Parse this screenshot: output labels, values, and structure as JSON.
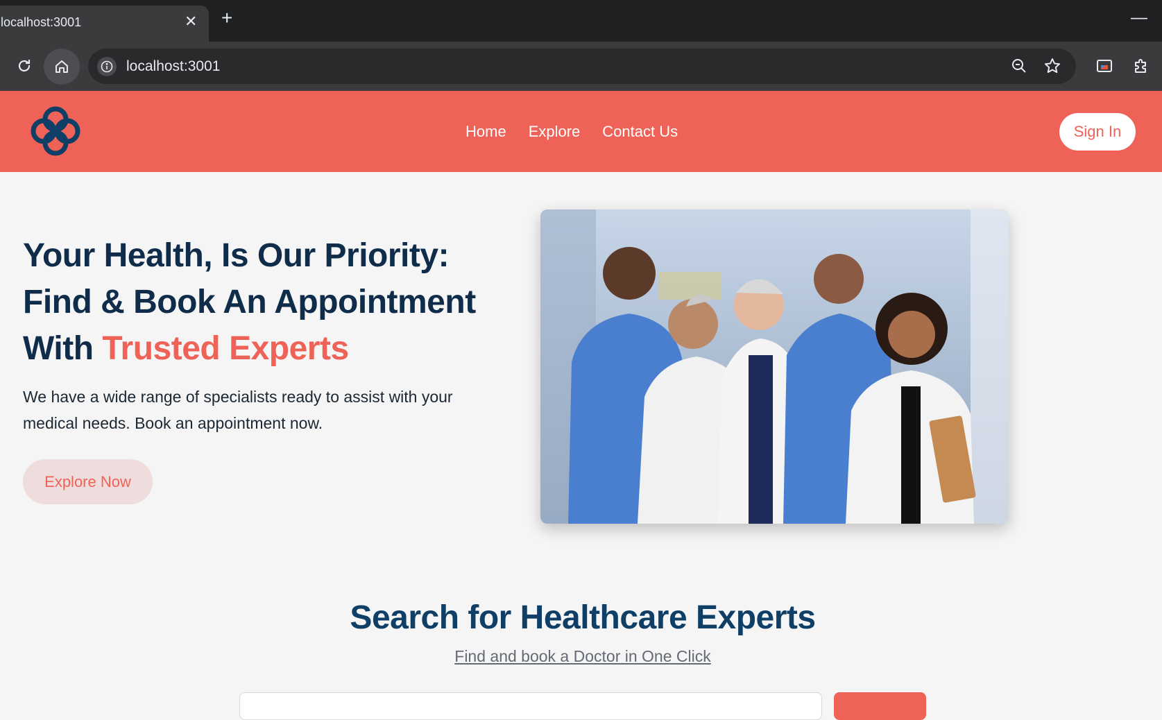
{
  "browser": {
    "tab_title": "localhost:3001",
    "tab_close": "✕",
    "new_tab": "+",
    "minimize": "—",
    "url": "localhost:3001"
  },
  "header": {
    "nav": [
      {
        "label": "Home"
      },
      {
        "label": "Explore"
      },
      {
        "label": "Contact Us"
      }
    ],
    "signin_label": "Sign In"
  },
  "hero": {
    "title_line1": "Your Health, Is Our Priority:",
    "title_line2": "Find & Book An Appointment",
    "title_line3_prefix": "With ",
    "title_accent": "Trusted Experts",
    "description": "We have a wide range of specialists ready to assist with your medical needs. Book an appointment now.",
    "cta_label": "Explore Now"
  },
  "search": {
    "title": "Search for Healthcare Experts",
    "subtitle": "Find and book a Doctor in One Click",
    "placeholder": ""
  },
  "colors": {
    "brand": "#ef6257",
    "navy": "#0f2c4a",
    "heading_blue": "#0f3f66"
  }
}
